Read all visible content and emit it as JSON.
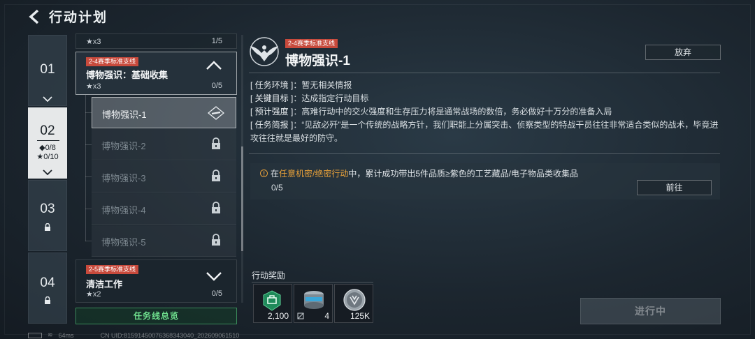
{
  "header": {
    "title": "行动计划"
  },
  "chapters": [
    {
      "num": "01"
    },
    {
      "num": "02",
      "diamond": "◆0/8",
      "star": "★0/10"
    },
    {
      "num": "03"
    },
    {
      "num": "04"
    }
  ],
  "missions": {
    "top_partial": {
      "stars": "★x3",
      "progress": "1/5"
    },
    "open": {
      "tag": "2-4赛季标准支线",
      "name": "博物强识：基础收集",
      "stars": "★x3",
      "progress": "0/5"
    },
    "sub_items": [
      "博物强识-1",
      "博物强识-2",
      "博物强识-3",
      "博物强识-4",
      "博物强识-5"
    ],
    "next": {
      "tag": "2-5赛季标准支线",
      "name": "清洁工作",
      "stars": "★x2",
      "progress": "0/5"
    },
    "overview_button": "任务线总览"
  },
  "detail": {
    "tag": "2-4赛季标准支线",
    "title": "博物强识-1",
    "abandon_button": "放弃",
    "info": [
      {
        "key": "[ 任务环境 ]",
        "value": "：暂无相关情报"
      },
      {
        "key": "[ 关键目标 ]",
        "value": "：达成指定行动目标"
      },
      {
        "key": "[ 预计强度 ]",
        "value": "：高难行动中的交火强度和生存压力将是通常战场的数倍，务必做好十万分的准备入局"
      },
      {
        "key": "[ 任务简报 ]",
        "value": "：“见敌必歼”是一个传统的战略方针，我们职能上分属突击、侦察类型的特战干员往往非常适合类似的战术，毕竟进攻往往就是最好的防守。"
      }
    ],
    "quest": {
      "prefix": "在",
      "highlight": "任意机密/绝密行动",
      "suffix": "中，累计成功带出5件品质≥紫色的工艺藏品/电子物品类收集品",
      "progress": "0/5",
      "goto_button": "前往"
    },
    "reward_label": "行动奖励",
    "rewards": [
      {
        "icon": "badge-icon",
        "count": "2,100"
      },
      {
        "icon": "canister-icon",
        "count": "4"
      },
      {
        "icon": "coin-icon",
        "count": "125K"
      }
    ],
    "in_progress_button": "进行中"
  },
  "footer": {
    "ping": "64ms",
    "uid": "CN UID:8159145007636834304​0_202609061510"
  },
  "colors": {
    "tag_red": "#c84a3c",
    "highlight_orange": "#e8a13a",
    "overview_green": "#6fe08e"
  }
}
